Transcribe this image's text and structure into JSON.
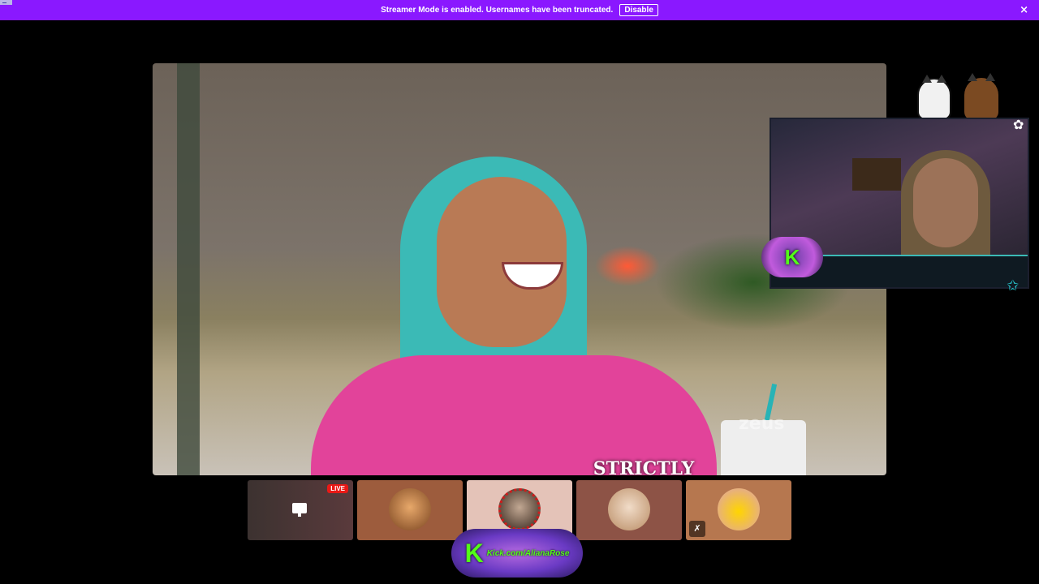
{
  "banner": {
    "message": "Streamer Mode is enabled. Usernames have been truncated.",
    "disable_label": "Disable",
    "close_icon": "×"
  },
  "main_video": {
    "watermark": "zeus",
    "hoodie_print": "STRICTLY"
  },
  "cam_overlay": {
    "logo_letter": "K",
    "star_icon": "✩",
    "flower_icon": "✿"
  },
  "participants": {
    "live_label": "LIVE",
    "mute_icon": "✗"
  },
  "kick_logo": {
    "letter": "K",
    "url": "Kick.com/AlianaRose"
  },
  "colors": {
    "banner": "#8a18ff",
    "live": "#e91916",
    "kick_green": "#53fc18"
  }
}
